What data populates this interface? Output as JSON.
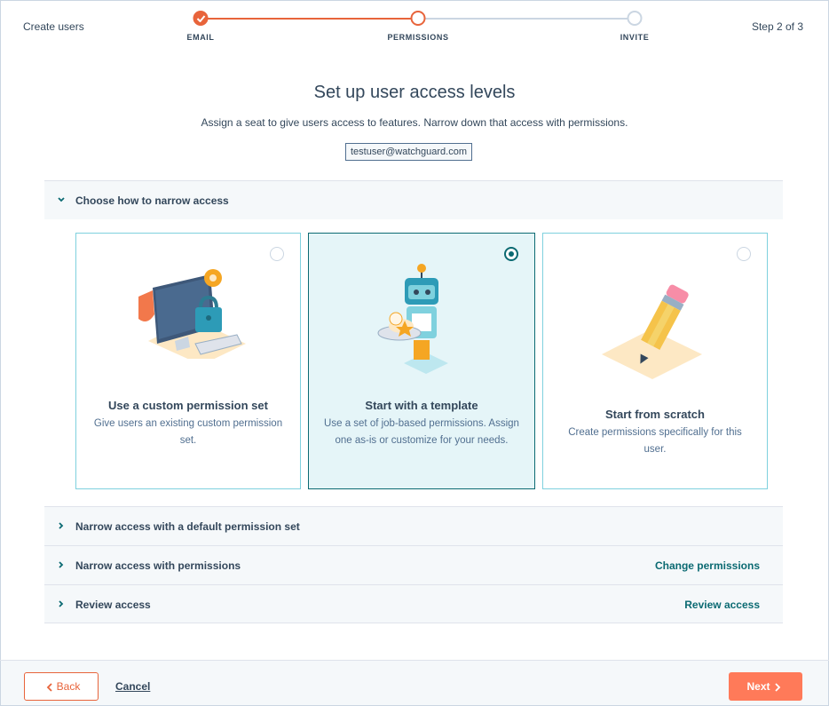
{
  "header": {
    "title": "Create users",
    "step_indicator": "Step 2 of 3",
    "steps": [
      {
        "label": "EMAIL",
        "state": "done"
      },
      {
        "label": "PERMISSIONS",
        "state": "current"
      },
      {
        "label": "INVITE",
        "state": "todo"
      }
    ]
  },
  "main": {
    "title": "Set up user access levels",
    "subtitle": "Assign a seat to give users access to features. Narrow down that access with permissions.",
    "email": "testuser@watchguard.com"
  },
  "accordion": {
    "open_section": "Choose how to narrow access",
    "sections": [
      {
        "label": "Narrow access with a default permission set",
        "action": ""
      },
      {
        "label": "Narrow access with permissions",
        "action": "Change permissions"
      },
      {
        "label": "Review access",
        "action": "Review access"
      }
    ]
  },
  "cards": [
    {
      "title": "Use a custom permission set",
      "description": "Give users an existing custom permission set.",
      "selected": false,
      "icon": "computer-lock-illustration"
    },
    {
      "title": "Start with a template",
      "description": "Use a set of job-based permissions. Assign one as-is or customize for your needs.",
      "selected": true,
      "icon": "robot-waiter-illustration"
    },
    {
      "title": "Start from scratch",
      "description": "Create permissions specifically for this user.",
      "selected": false,
      "icon": "pencil-illustration"
    }
  ],
  "footer": {
    "back_label": "Back",
    "cancel_label": "Cancel",
    "next_label": "Next"
  },
  "colors": {
    "accent": "#ff7a59",
    "accent_dark": "#e8643b",
    "teal": "#0b6a72",
    "text": "#33475b"
  }
}
